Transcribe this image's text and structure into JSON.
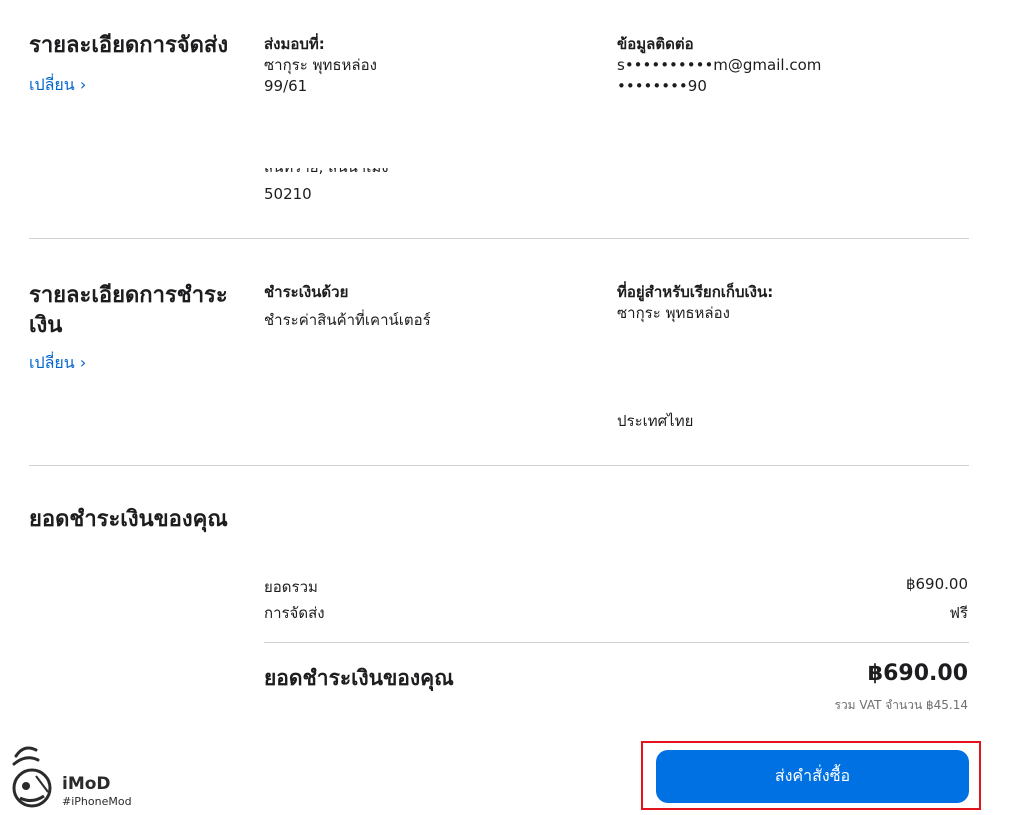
{
  "shipping": {
    "title": "รายละเอียดการจัดส่ง",
    "change_label": "เปลี่ยน ›",
    "delivery_label": "ส่งมอบที่:",
    "recipient_name": "ซากุระ พุทธหล่อง",
    "address_line1": "99/61",
    "address_clipped": "สันทราย, สันนาเม็ง",
    "postal_code": "50210",
    "contact_label": "ข้อมูลติดต่อ",
    "contact_email": "s••••••••••m@gmail.com",
    "contact_phone": "••••••••90"
  },
  "payment": {
    "title_line1": "รายละเอียดการชำระ",
    "title_line2": "เงิน",
    "change_label": "เปลี่ยน ›",
    "method_label": "ชำระเงินด้วย",
    "method_value": "ชำระค่าสินค้าที่เคาน์เตอร์",
    "billing_label": "ที่อยู่สำหรับเรียกเก็บเงิน:",
    "billing_name": "ซากุระ พุทธหล่อง",
    "billing_country": "ประเทศไทย"
  },
  "summary": {
    "title": "ยอดชำระเงินของคุณ",
    "subtotal_label": "ยอดรวม",
    "subtotal_value": "฿690.00",
    "shipping_label": "การจัดส่ง",
    "shipping_value": "ฟรี",
    "total_label": "ยอดชำระเงินของคุณ",
    "total_value": "฿690.00",
    "vat_note": "รวม VAT จำนวน ฿45.14"
  },
  "order_button": {
    "label": "ส่งคำสั่งซื้อ"
  },
  "watermark": {
    "name": "iMoD",
    "tag": "#iPhoneMod"
  },
  "colors": {
    "accent": "#0071e3",
    "link": "#0066cc",
    "highlight": "#e3121c",
    "divider": "#d2d2d7"
  }
}
